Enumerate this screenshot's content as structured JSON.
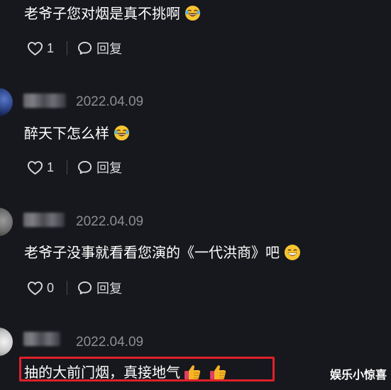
{
  "comments": [
    {
      "text": "老爷子您对烟是真不挑啊",
      "emoji": "rolling-laugh-emoji",
      "likes": "1",
      "reply_label": "回复"
    },
    {
      "date": "2022.04.09",
      "text": "醉天下怎么样",
      "emoji": "rolling-laugh-emoji",
      "likes": "1",
      "reply_label": "回复"
    },
    {
      "date": "2022.04.09",
      "text": "老爷子没事就看看您演的《一代洪商》吧",
      "emoji": "grinning-emoji",
      "likes": "0",
      "reply_label": "回复"
    },
    {
      "date": "2022.04.09",
      "text": "抽的大前门烟，真接地气",
      "emoji": "thumbs-up-emoji",
      "highlight_color": "#e0202a"
    }
  ],
  "watermark": "娱乐小惊喜",
  "colors": {
    "background": "#17181d",
    "text": "#ffffff",
    "muted": "#8d8d93",
    "highlight": "#e0202a"
  }
}
